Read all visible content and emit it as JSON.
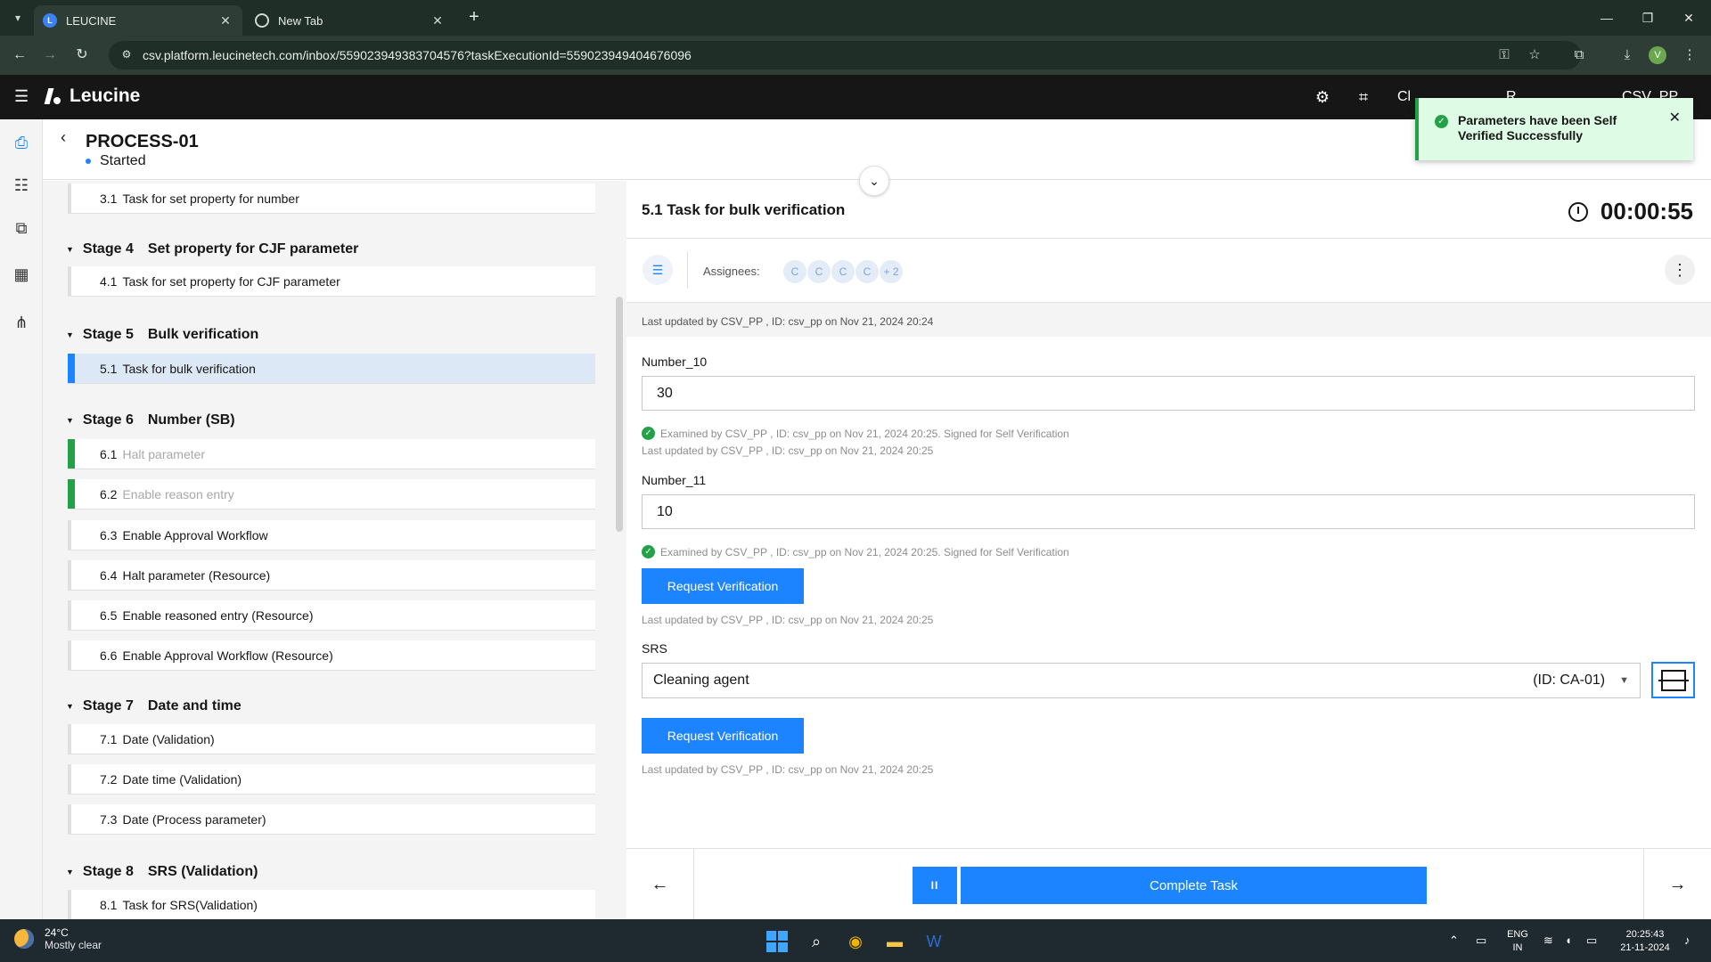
{
  "browser": {
    "tabs": [
      {
        "label": "LEUCINE",
        "active": true
      },
      {
        "label": "New Tab",
        "active": false
      }
    ],
    "url": "csv.platform.leucinetech.com/inbox/559023949383704576?taskExecutionId=559023949404676096",
    "profile_initial": "V"
  },
  "app": {
    "brand": "Leucine",
    "header_right": [
      "Cl",
      "R",
      "CSV_PP"
    ]
  },
  "toast": {
    "message": "Parameters have been Self Verified Successfully"
  },
  "process": {
    "title": "PROCESS-01",
    "status": "Started"
  },
  "stages": {
    "pre_task": {
      "num": "3.1",
      "label": "Task for set property for number"
    },
    "s4": {
      "num": "Stage 4",
      "name": "Set property for CJF parameter",
      "tasks": [
        {
          "num": "4.1",
          "label": "Task for set property for CJF parameter"
        }
      ]
    },
    "s5": {
      "num": "Stage 5",
      "name": "Bulk verification",
      "tasks": [
        {
          "num": "5.1",
          "label": "Task for bulk verification"
        }
      ]
    },
    "s6": {
      "num": "Stage 6",
      "name": "Number (SB)",
      "tasks": [
        {
          "num": "6.1",
          "label": "Halt parameter"
        },
        {
          "num": "6.2",
          "label": "Enable reason entry"
        },
        {
          "num": "6.3",
          "label": "Enable Approval Workflow"
        },
        {
          "num": "6.4",
          "label": "Halt parameter (Resource)"
        },
        {
          "num": "6.5",
          "label": "Enable reasoned entry (Resource)"
        },
        {
          "num": "6.6",
          "label": "Enable Approval Workflow (Resource)"
        }
      ]
    },
    "s7": {
      "num": "Stage 7",
      "name": "Date and time",
      "tasks": [
        {
          "num": "7.1",
          "label": "Date (Validation)"
        },
        {
          "num": "7.2",
          "label": "Date time (Validation)"
        },
        {
          "num": "7.3",
          "label": "Date (Process parameter)"
        }
      ]
    },
    "s8": {
      "num": "Stage 8",
      "name": "SRS (Validation)",
      "tasks": [
        {
          "num": "8.1",
          "label": "Task for SRS(Validation)"
        }
      ]
    }
  },
  "task": {
    "title": "5.1 Task for bulk verification",
    "timer": "00:00:55",
    "assignees_label": "Assignees:",
    "assignees": [
      "C",
      "C",
      "C",
      "C"
    ],
    "assignees_more": "+ 2",
    "last_updated": "Last updated by CSV_PP , ID: csv_pp on Nov 21, 2024 20:24",
    "params": [
      {
        "label": "Number_10",
        "value": "30",
        "examined": "Examined by CSV_PP , ID: csv_pp on Nov 21, 2024 20:25. Signed for Self Verification",
        "updated": "Last updated by CSV_PP , ID: csv_pp on Nov 21, 2024 20:25"
      },
      {
        "label": "Number_11",
        "value": "10",
        "examined": "Examined by CSV_PP , ID: csv_pp on Nov 21, 2024 20:25. Signed for Self Verification",
        "request_label": "Request Verification",
        "updated": "Last updated by CSV_PP , ID: csv_pp on Nov 21, 2024 20:25"
      },
      {
        "label": "SRS",
        "value": "Cleaning agent",
        "id": "(ID: CA-01)",
        "request_label": "Request Verification",
        "updated": "Last updated by CSV_PP , ID: csv_pp on Nov 21, 2024 20:25"
      }
    ],
    "complete_label": "Complete Task",
    "pause_glyph": "II"
  },
  "taskbar": {
    "temp": "24°C",
    "weather": "Mostly clear",
    "lang": "ENG",
    "region": "IN",
    "time": "20:25:43",
    "date": "21-11-2024"
  },
  "icons": {
    "colors": {
      "accent": "#1d84ff",
      "success": "#24a148",
      "header_bg": "#161616",
      "chrome_bg": "#1f2e26"
    }
  }
}
